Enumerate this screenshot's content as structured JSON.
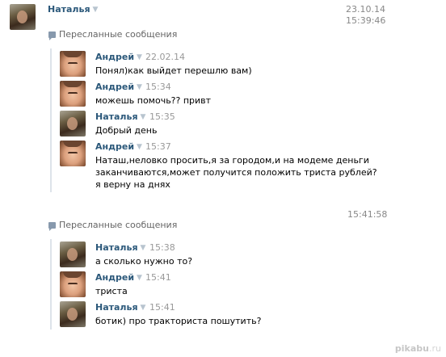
{
  "top_message": {
    "author": "Наталья",
    "date": "23.10.14",
    "time": "15:39:46"
  },
  "forward_groups": [
    {
      "label": "Пересланные сообщения",
      "messages": [
        {
          "author": "Андрей",
          "time": "22.02.14",
          "lines": [
            "Понял)как выйдет перешлю вам)"
          ]
        },
        {
          "author": "Андрей",
          "time": "15:34",
          "lines": [
            "можешь помочь?? привт"
          ]
        },
        {
          "author": "Наталья",
          "time": "15:35",
          "lines": [
            "Добрый день"
          ]
        },
        {
          "author": "Андрей",
          "time": "15:37",
          "lines": [
            "Наташ,неловко просить,я за городом,и на модеме деньги",
            "заканчиваются,может получится положить триста рублей?",
            "я верну на днях"
          ]
        }
      ]
    },
    {
      "label": "Пересланные сообщения",
      "messages": [
        {
          "author": "Наталья",
          "time": "15:38",
          "lines": [
            "а сколько нужно то?"
          ]
        },
        {
          "author": "Андрей",
          "time": "15:41",
          "lines": [
            "триста"
          ]
        },
        {
          "author": "Наталья",
          "time": "15:41",
          "lines": [
            "ботик) про тракториста пошутить?"
          ]
        }
      ]
    }
  ],
  "second_message_time": "15:41:58",
  "watermark": {
    "brand": "pikabu",
    "suffix": ".ru"
  },
  "icons": {
    "forward": "forward-icon",
    "dropdown": "dropdown-triangle-icon"
  }
}
